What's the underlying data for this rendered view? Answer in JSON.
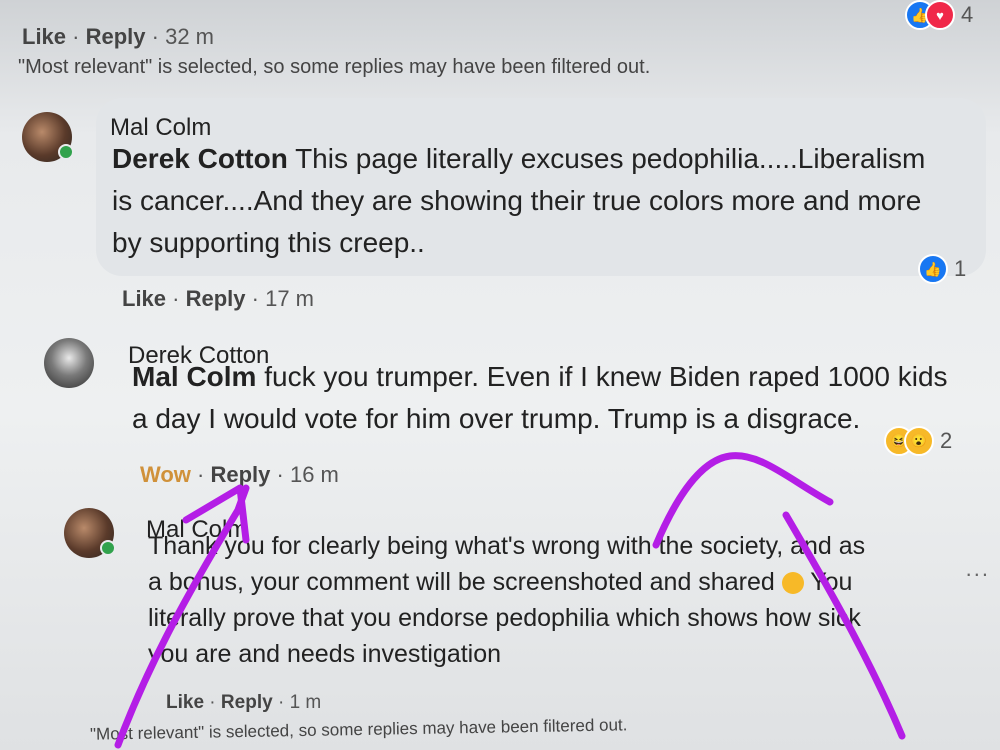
{
  "top_reactions": {
    "count": "4"
  },
  "top_meta": {
    "like": "Like",
    "reply": "Reply",
    "time": "32 m"
  },
  "notice_top": "\"Most relevant\" is selected, so some replies may have been filtered out.",
  "comment1": {
    "author": "Mal Colm",
    "mention": "Derek Cotton",
    "text_line1": " This page literally excuses pedophilia.....Liberalism",
    "text_line2": "is cancer....And they are showing their true colors more and more",
    "text_line3": "by supporting this creep..",
    "reaction_count": "1",
    "like": "Like",
    "reply": "Reply",
    "time": "17 m"
  },
  "comment2": {
    "author": "Derek Cotton",
    "mention": "Mal Colm",
    "text_line1": " fuck you trumper. Even if I knew Biden raped 1000 kids",
    "text_line2": "a day I would vote for him over trump. Trump is a disgrace.",
    "reaction_count": "2",
    "wow": "Wow",
    "reply": "Reply",
    "time": "16 m"
  },
  "comment3": {
    "author": "Mal Colm",
    "text_line1": "Thank you for clearly being what's wrong with the society, and as",
    "text_line2": "a bonus, your comment will be screenshoted and shared",
    "text_line2b": "You",
    "text_line3": "literally prove that you endorse pedophilia which shows how sick",
    "text_line4": "you are and needs investigation",
    "like": "Like",
    "reply": "Reply",
    "time": "1 m"
  },
  "more_options": "...",
  "notice_bottom": "\"Most relevant\" is selected, so some replies may have been filtered out.",
  "colors": {
    "like_blue": "#1877f2",
    "annotation_purple": "#b41ee6",
    "wow_orange": "#d0913a"
  }
}
